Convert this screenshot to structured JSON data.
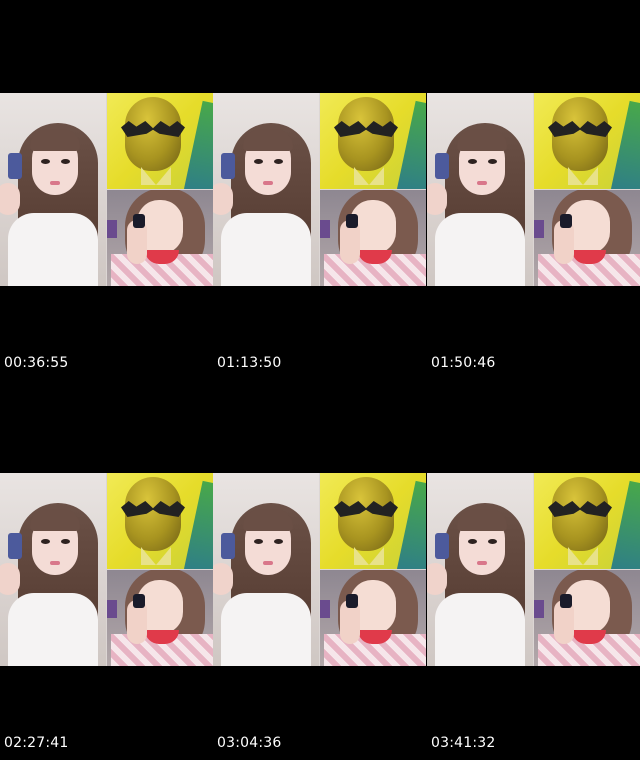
{
  "contact_sheet": {
    "thumbnails": [
      {
        "timestamp": "00:36:55"
      },
      {
        "timestamp": "01:13:50"
      },
      {
        "timestamp": "01:50:46"
      },
      {
        "timestamp": "02:27:41"
      },
      {
        "timestamp": "03:04:36"
      },
      {
        "timestamp": "03:41:32"
      }
    ]
  },
  "colors": {
    "background": "#000000",
    "timestamp_text": "#ffffff"
  }
}
